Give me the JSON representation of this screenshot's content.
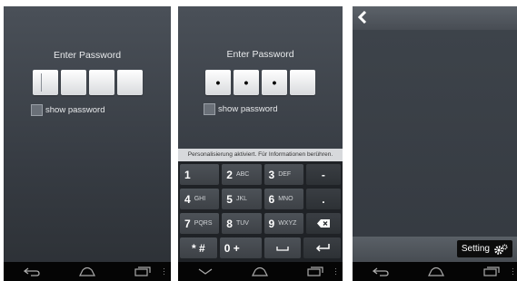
{
  "screen1": {
    "title": "Enter Password",
    "show_password": "show password",
    "digits": [
      "",
      "",
      "",
      ""
    ]
  },
  "screen2": {
    "title": "Enter Password",
    "show_password": "show password",
    "digits": [
      "•",
      "•",
      "•",
      ""
    ],
    "keyboard_hint": "Personalisierung aktiviert. Für Informationen berühren.",
    "keys": [
      [
        {
          "main": "1",
          "sub": ""
        },
        {
          "main": "2",
          "sub": "ABC"
        },
        {
          "main": "3",
          "sub": "DEF"
        },
        {
          "main": "-",
          "sub": ""
        }
      ],
      [
        {
          "main": "4",
          "sub": "GHI"
        },
        {
          "main": "5",
          "sub": "JKL"
        },
        {
          "main": "6",
          "sub": "MNO"
        },
        {
          "main": ".",
          "sub": ""
        }
      ],
      [
        {
          "main": "7",
          "sub": "PQRS"
        },
        {
          "main": "8",
          "sub": "TUV"
        },
        {
          "main": "9",
          "sub": "WXYZ"
        },
        {
          "main": "",
          "sub": ""
        }
      ],
      [
        {
          "main": "* #",
          "sub": ""
        },
        {
          "main": "0 +",
          "sub": ""
        },
        {
          "main": "",
          "sub": ""
        },
        {
          "main": "",
          "sub": ""
        }
      ]
    ]
  },
  "screen3": {
    "setting_label": "Setting"
  },
  "icons": {
    "back": "back-icon",
    "home": "home-icon",
    "recents": "recents-icon",
    "backspace": "backspace-icon",
    "enter": "enter-icon",
    "space": "space-icon",
    "gear": "gear-icon"
  }
}
